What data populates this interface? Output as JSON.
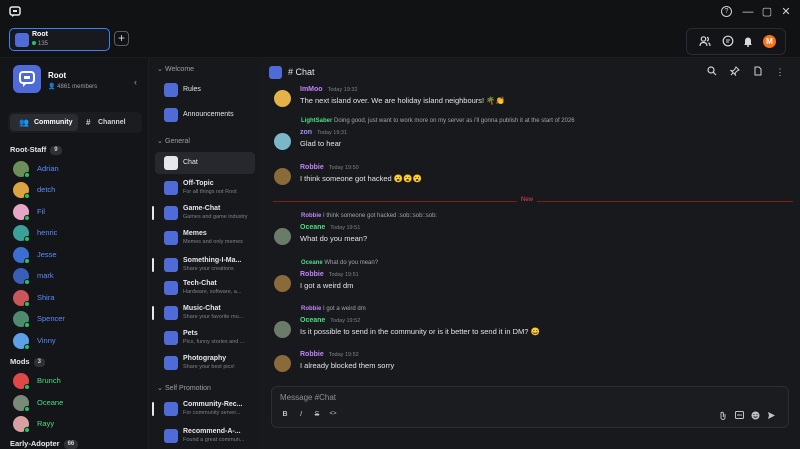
{
  "titlebar": {
    "help": "?",
    "minimize": "—",
    "maximize": "▢",
    "close": "✕"
  },
  "server_tab": {
    "name": "Root",
    "count": "135"
  },
  "topbar": {
    "add": "+",
    "friends": "👥",
    "chat": "💬",
    "bell": "🔔",
    "avatar_letter": "M"
  },
  "server": {
    "name": "Root",
    "members": "4861 members",
    "collapse": "‹"
  },
  "tabs": {
    "community": "Community",
    "channel": "Channel"
  },
  "roles": [
    {
      "name": "Root-Staff",
      "count": "9"
    },
    {
      "name": "Mods",
      "count": "3"
    },
    {
      "name": "Early-Adopter",
      "count": "66"
    }
  ],
  "members": [
    {
      "name": "Adrian",
      "color": "#5b8cff"
    },
    {
      "name": "detch",
      "color": "#5b8cff"
    },
    {
      "name": "Fil",
      "color": "#5b8cff"
    },
    {
      "name": "henric",
      "color": "#5b8cff"
    },
    {
      "name": "Jesse",
      "color": "#5b8cff"
    },
    {
      "name": "mark",
      "color": "#5b8cff"
    },
    {
      "name": "Shira",
      "color": "#5b8cff"
    },
    {
      "name": "Spencer",
      "color": "#5b8cff"
    },
    {
      "name": "Vinny",
      "color": "#5b8cff"
    },
    {
      "name": "Brunch",
      "color": "#4ade80"
    },
    {
      "name": "Oceane",
      "color": "#4ade80"
    },
    {
      "name": "Rayy",
      "color": "#4ade80"
    }
  ],
  "categories": {
    "welcome": "Welcome",
    "general": "General",
    "self_promotion": "Self Promotion"
  },
  "channels": [
    {
      "name": "Rules",
      "desc": ""
    },
    {
      "name": "Announcements",
      "desc": ""
    },
    {
      "name": "Chat",
      "desc": ""
    },
    {
      "name": "Off-Topic",
      "desc": "For all things not Root"
    },
    {
      "name": "Game-Chat",
      "desc": "Games and game industry"
    },
    {
      "name": "Memes",
      "desc": "Memes and only memes"
    },
    {
      "name": "Something-I-Ma...",
      "desc": "Share your creations"
    },
    {
      "name": "Tech-Chat",
      "desc": "Hardware, software, a..."
    },
    {
      "name": "Music-Chat",
      "desc": "Share your favorite mu..."
    },
    {
      "name": "Pets",
      "desc": "Pics, funny stories and ..."
    },
    {
      "name": "Photography",
      "desc": "Share your best pics!"
    },
    {
      "name": "Community-Rec...",
      "desc": "For community server..."
    },
    {
      "name": "Recommend-A-...",
      "desc": "Found a great commun..."
    }
  ],
  "chat": {
    "title": "# Chat"
  },
  "messages": [
    {
      "user": "ImMoo",
      "time": "Today 19:32",
      "text": "The next island over. We are holiday island neighbours! 🌴👏"
    },
    {
      "reply_user": "LightSaber",
      "reply_text": "Doing good, just want to work more on my server as i'll gonna publish it at the start of 2026",
      "user": "zon",
      "time": "Today 19:31",
      "text": "Glad to hear"
    },
    {
      "user": "Robbie",
      "time": "Today 19:50",
      "text": "I think someone got hacked 😮😮😮"
    },
    {
      "reply_user": "Robbie",
      "reply_text": "I think someone got hacked :sob::sob::sob:",
      "user": "Oceane",
      "time": "Today 19:51",
      "text": "What do you mean?"
    },
    {
      "reply_user": "Oceane",
      "reply_text": "What do you mean?",
      "user": "Robbie",
      "time": "Today 19:51",
      "text": "I got a weird dm"
    },
    {
      "reply_user": "Robbie",
      "reply_text": "I got a weird dm",
      "user": "Oceane",
      "time": "Today 19:52",
      "text": "Is it possible to send in the community or is it better to send it in DM? 😄"
    },
    {
      "user": "Robbie",
      "time": "Today 19:52",
      "text": "I already blocked them sorry"
    }
  ],
  "new_label": "New",
  "composer": {
    "placeholder": "Message #Chat",
    "bold": "B",
    "italic": "I",
    "strike": "S",
    "code": "<>"
  },
  "colors": {
    "accent": "#4f6bd8",
    "bg": "#18191d",
    "new_divider": "#ef4444",
    "online": "#22c55e"
  }
}
